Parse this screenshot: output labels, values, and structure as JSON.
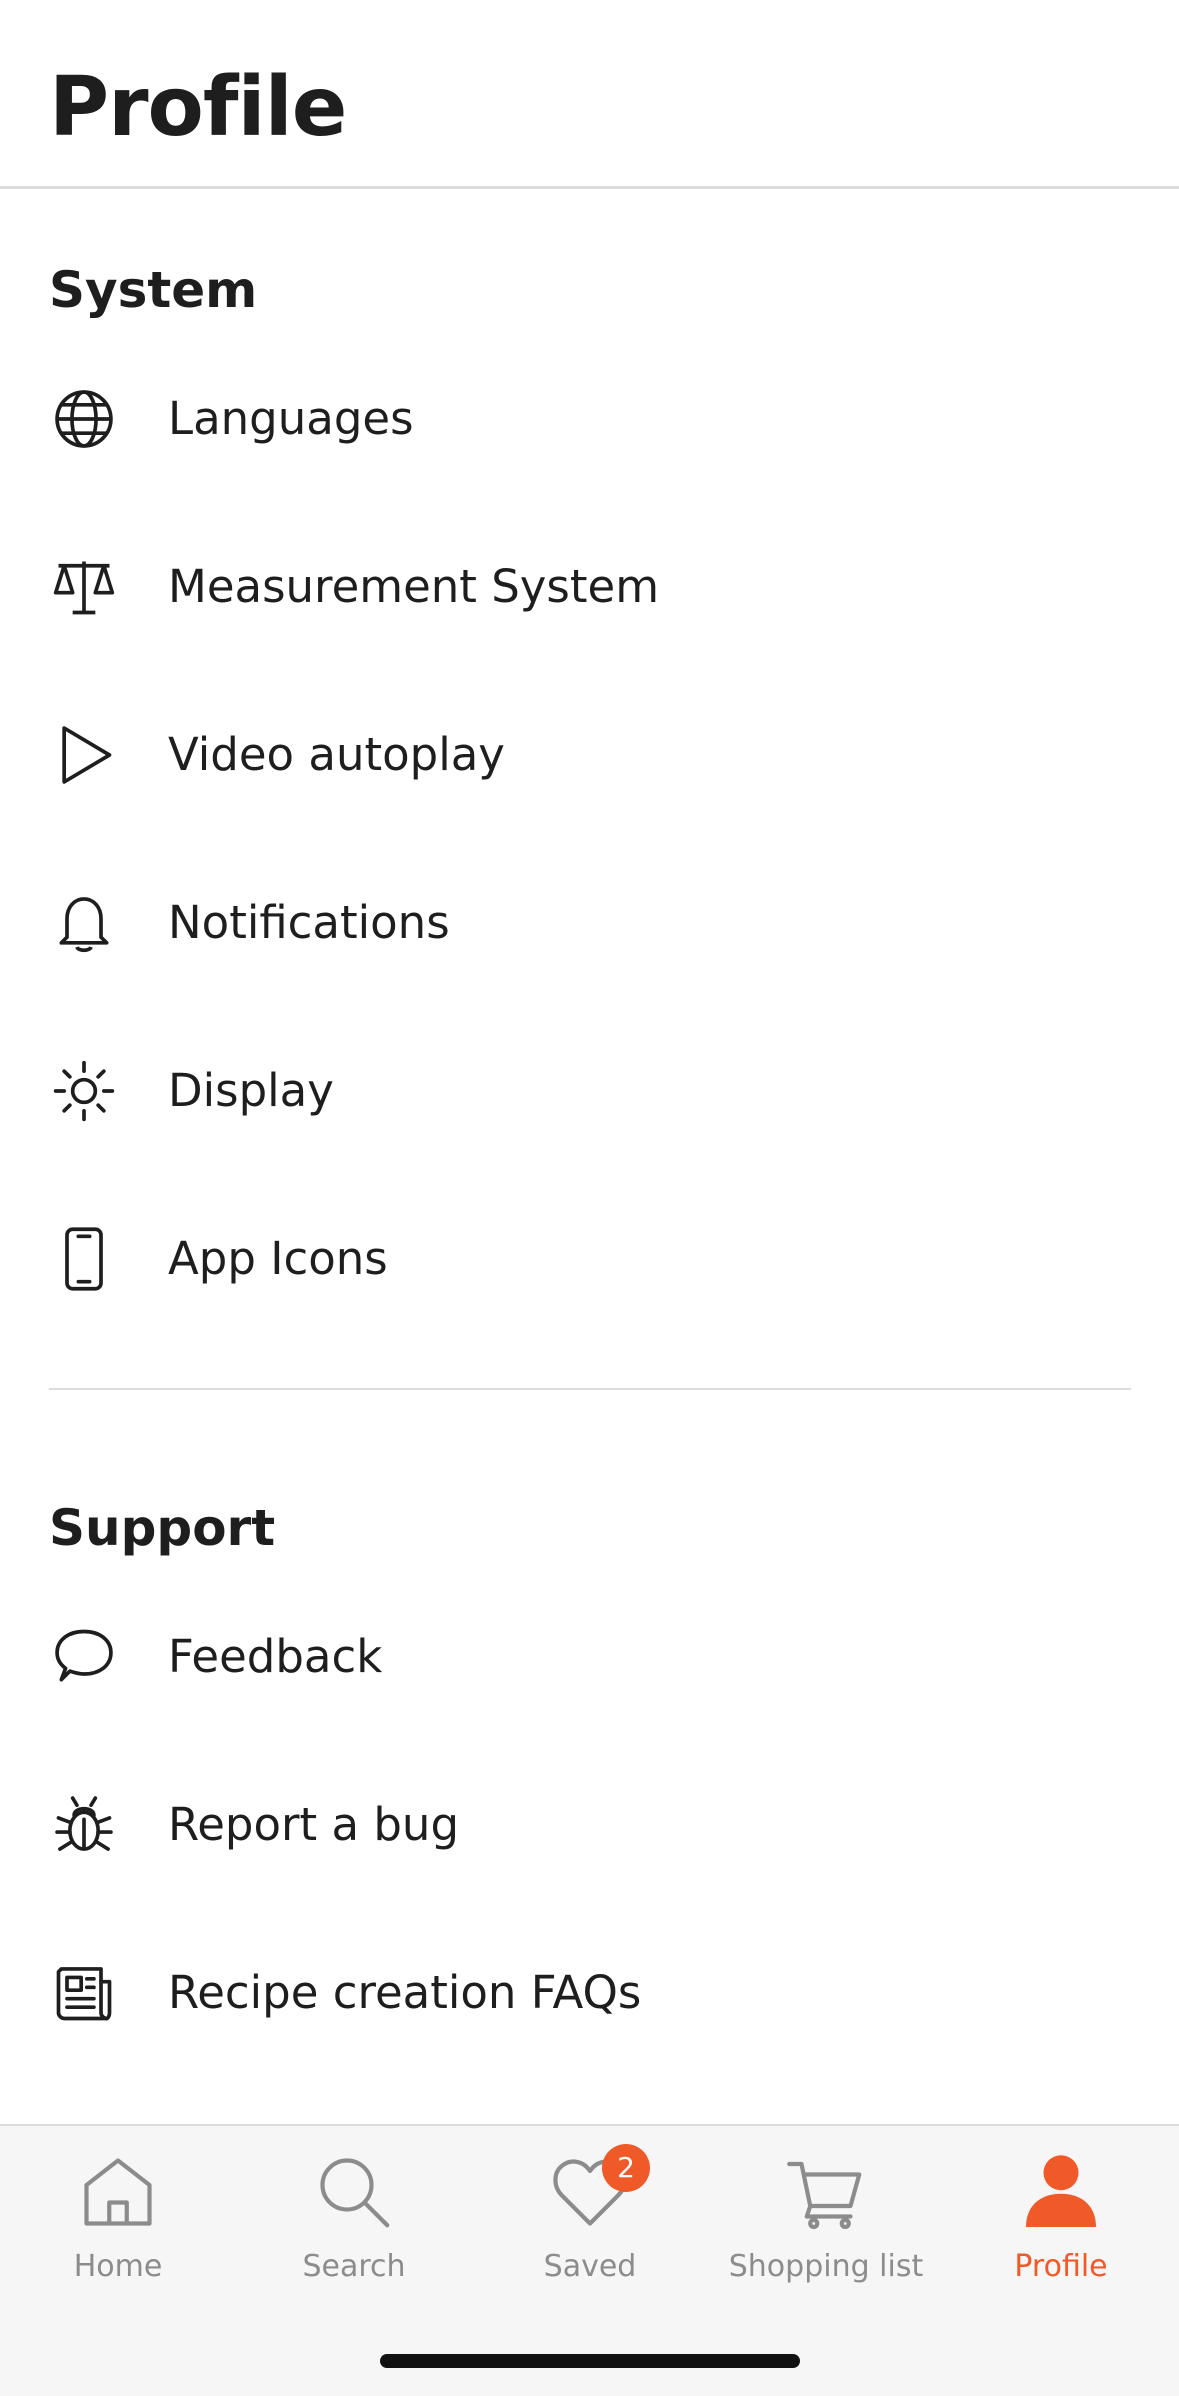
{
  "header": {
    "title": "Profile"
  },
  "sections": {
    "system": {
      "title": "System",
      "items": [
        {
          "label": "Languages",
          "icon": "globe-icon"
        },
        {
          "label": "Measurement System",
          "icon": "scale-icon"
        },
        {
          "label": "Video autoplay",
          "icon": "play-icon"
        },
        {
          "label": "Notifications",
          "icon": "bell-icon"
        },
        {
          "label": "Display",
          "icon": "sun-icon"
        },
        {
          "label": "App Icons",
          "icon": "phone-icon"
        }
      ]
    },
    "support": {
      "title": "Support",
      "items": [
        {
          "label": "Feedback",
          "icon": "chat-bubble-icon"
        },
        {
          "label": "Report a bug",
          "icon": "bug-icon"
        },
        {
          "label": "Recipe creation FAQs",
          "icon": "newspaper-icon"
        }
      ]
    }
  },
  "tabbar": {
    "tabs": [
      {
        "label": "Home",
        "icon": "home-icon"
      },
      {
        "label": "Search",
        "icon": "search-icon"
      },
      {
        "label": "Saved",
        "icon": "heart-icon",
        "badge": "2"
      },
      {
        "label": "Shopping list",
        "icon": "cart-icon"
      },
      {
        "label": "Profile",
        "icon": "person-icon",
        "active": true
      }
    ]
  },
  "colors": {
    "accent": "#f05a28",
    "text": "#1e1e1e",
    "muted": "#8c8c8c",
    "divider": "#dcdcdc",
    "tabbar_bg": "#f6f6f6"
  }
}
